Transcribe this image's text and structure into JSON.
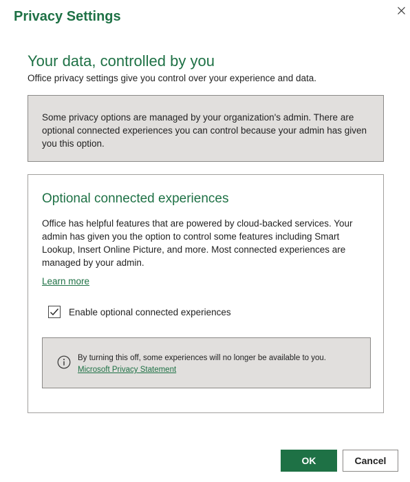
{
  "dialog": {
    "title": "Privacy Settings",
    "close_icon": "close-icon"
  },
  "intro": {
    "heading": "Your data, controlled by you",
    "subheading": "Office privacy settings give you control over your experience and data."
  },
  "admin_notice": {
    "text": "Some privacy options are managed by your organization's admin. There are optional connected experiences you can control because your admin has given you this option."
  },
  "optional_experiences": {
    "heading": "Optional connected experiences",
    "body": "Office has helpful features that are powered by cloud-backed services. Your admin has given you the option to control some features including Smart Lookup, Insert Online Picture, and more. Most connected experiences are managed by your admin.",
    "learn_more": "Learn more",
    "checkbox_label": "Enable optional connected experiences",
    "checkbox_checked": true,
    "info": {
      "icon": "info-icon",
      "text": "By turning this off, some experiences will no longer be available to you.",
      "link": "Microsoft Privacy Statement"
    }
  },
  "footer": {
    "ok_label": "OK",
    "cancel_label": "Cancel"
  },
  "colors": {
    "accent": "#1e7145",
    "notice_background": "#e1dfdd"
  }
}
